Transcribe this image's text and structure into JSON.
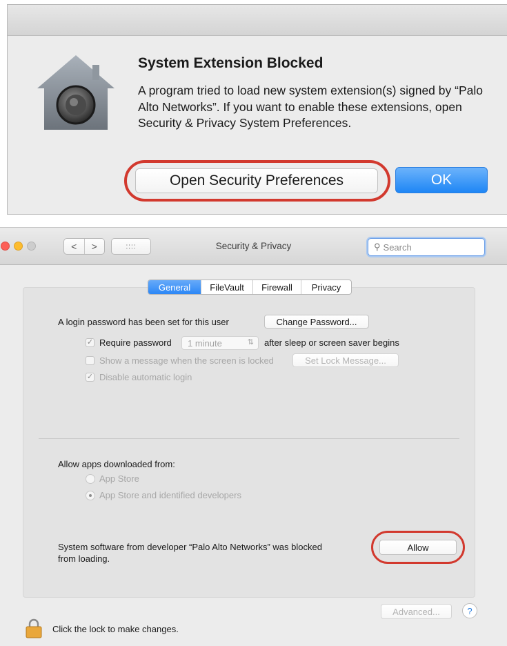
{
  "alert": {
    "title": "System Extension Blocked",
    "message": "A program tried to load new system extension(s) signed by “Palo Alto Networks”.  If you want to enable these extensions, open Security & Privacy System Preferences.",
    "open_button": "Open Security Preferences",
    "ok_button": "OK",
    "icon": "security-lock-house-icon",
    "highlight_color": "#d2392e",
    "default_button_color": "#1e86f5"
  },
  "window": {
    "title": "Security & Privacy",
    "search_placeholder": "Search",
    "nav_back": "<",
    "nav_forward": ">",
    "grid_glyph": "::::",
    "tabs": [
      {
        "label": "General",
        "active": true
      },
      {
        "label": "FileVault",
        "active": false
      },
      {
        "label": "Firewall",
        "active": false
      },
      {
        "label": "Privacy",
        "active": false
      }
    ]
  },
  "general": {
    "login_password_text": "A login password has been set for this user",
    "change_password_button": "Change Password...",
    "require_password_label": "Require password",
    "require_password_checked": true,
    "require_password_delay": "1 minute",
    "require_password_suffix": "after sleep or screen saver begins",
    "show_message_label": "Show a message when the screen is locked",
    "show_message_checked": false,
    "set_lock_message_button": "Set Lock Message...",
    "disable_auto_login_label": "Disable automatic login",
    "disable_auto_login_checked": true,
    "allow_apps_heading": "Allow apps downloaded from:",
    "app_store_option": "App Store",
    "app_store_identified_option": "App Store and identified developers",
    "selected_source": "App Store and identified developers",
    "blocked_line1": "System software from developer “Palo Alto Networks” was blocked",
    "blocked_line2": "from loading.",
    "allow_button": "Allow"
  },
  "footer": {
    "lock_text": "Click the lock to make changes.",
    "advanced_button": "Advanced...",
    "help_button": "?"
  }
}
